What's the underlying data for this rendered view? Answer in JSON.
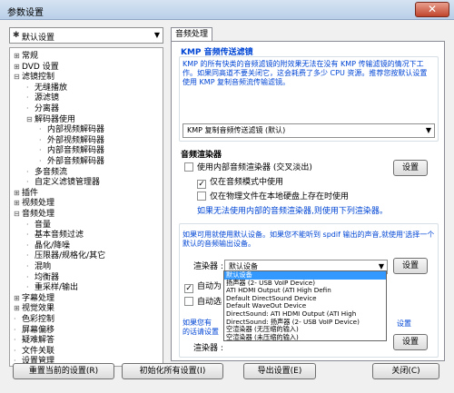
{
  "window": {
    "title": "参数设置"
  },
  "left": {
    "profile": "默认设置",
    "tree": [
      {
        "label": "常规",
        "level": 0,
        "toggle": "+"
      },
      {
        "label": "DVD 设置",
        "level": 0,
        "toggle": "+"
      },
      {
        "label": "滤镜控制",
        "level": 0,
        "toggle": "-"
      },
      {
        "label": "无缝播放",
        "level": 1,
        "toggle": ""
      },
      {
        "label": "源滤镜",
        "level": 1,
        "toggle": ""
      },
      {
        "label": "分离器",
        "level": 1,
        "toggle": ""
      },
      {
        "label": "解码器使用",
        "level": 1,
        "toggle": "-"
      },
      {
        "label": "内部视频解码器",
        "level": 2,
        "toggle": ""
      },
      {
        "label": "外部视频解码器",
        "level": 2,
        "toggle": ""
      },
      {
        "label": "内部音频解码器",
        "level": 2,
        "toggle": ""
      },
      {
        "label": "外部音频解码器",
        "level": 2,
        "toggle": ""
      },
      {
        "label": "多音频流",
        "level": 1,
        "toggle": ""
      },
      {
        "label": "自定义滤镜管理器",
        "level": 1,
        "toggle": ""
      },
      {
        "label": "插件",
        "level": 0,
        "toggle": "+"
      },
      {
        "label": "视频处理",
        "level": 0,
        "toggle": "+"
      },
      {
        "label": "音频处理",
        "level": 0,
        "toggle": "-"
      },
      {
        "label": "音量",
        "level": 1,
        "toggle": ""
      },
      {
        "label": "基本音频过滤",
        "level": 1,
        "toggle": ""
      },
      {
        "label": "晶化/降噪",
        "level": 1,
        "toggle": ""
      },
      {
        "label": "压限器/规格化/其它",
        "level": 1,
        "toggle": ""
      },
      {
        "label": "混响",
        "level": 1,
        "toggle": ""
      },
      {
        "label": "均衡器",
        "level": 1,
        "toggle": ""
      },
      {
        "label": "重采样/输出",
        "level": 1,
        "toggle": ""
      },
      {
        "label": "字幕处理",
        "level": 0,
        "toggle": "+"
      },
      {
        "label": "视觉效果",
        "level": 0,
        "toggle": "+"
      },
      {
        "label": "色彩控制",
        "level": 0,
        "toggle": ""
      },
      {
        "label": "屏幕偏移",
        "level": 0,
        "toggle": ""
      },
      {
        "label": "疑难解答",
        "level": 0,
        "toggle": ""
      },
      {
        "label": "文件关联",
        "level": 0,
        "toggle": ""
      },
      {
        "label": "设置管理",
        "level": 0,
        "toggle": ""
      }
    ]
  },
  "tab": {
    "label": "音频处理"
  },
  "kmp": {
    "title": "KMP 音频传送滤镜",
    "desc": "KMP 的所有快类的音频滤镜的附效果无法在没有 KMP 传输滤镜的情况下工作。如果同高道不要关闭它，这会耗费了多少 CPU 资源。推荐您按默认设置使用 KMP 复制音频流传输滤镜。",
    "select": "KMP 复制音频传送滤镜 (默认)"
  },
  "renderer": {
    "title": "音频渲染器",
    "opt1": "使用内部音频渲染器 (交叉淡出)",
    "opt1_checked": false,
    "opt2": "仅在音频模式中使用",
    "opt2_checked": true,
    "opt3": "仅在物理文件在本地硬盘上存在时使用",
    "opt3_checked": false,
    "settings_btn": "设置",
    "note": "如果无法使用内部的音频渲染器,则使用下列渲染器。"
  },
  "fallback": {
    "note": "如果可用就使用默认设备。如果您不能听到 spdif 输出的声音,就使用'选择一个默认的音频输出设备。",
    "label": "渲染器 :",
    "value": "默认设备",
    "settings_btn": "设置",
    "autofor_label": "自动为",
    "autofor_checked": true,
    "autoselect_label": "自动选",
    "autoselect_checked": false,
    "note2_line1": "如果您有",
    "note2_line2": "的话请设置",
    "note2_tail": "设置",
    "label2": "渲染器 :",
    "settings_btn2": "设置",
    "options": [
      "默认设备",
      "扬声器 (2- USB VoIP Device)",
      "ATI HDMI Output (ATI High Defin",
      "Default DirectSound Device",
      "Default WaveOut Device",
      "DirectSound: ATI HDMI Output (ATI High",
      "DirectSound: 扬声器 (2- USB VoIP Device)",
      "空渲染器 (无压缩的输入)",
      "空渲染器 (未压缩的输入)"
    ]
  },
  "footer": {
    "reset": "重置当前的设置(R)",
    "init": "初始化所有设置(I)",
    "export": "导出设置(E)",
    "close": "关闭(C)"
  }
}
